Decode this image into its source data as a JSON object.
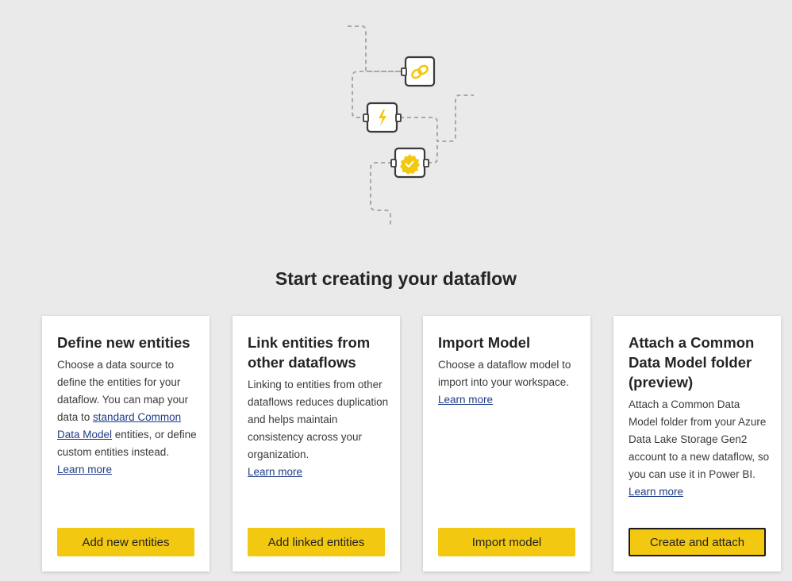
{
  "page": {
    "title": "Start creating your dataflow"
  },
  "illustration": {
    "icons": [
      "link-icon",
      "lightning-icon",
      "verified-badge-icon"
    ],
    "accent": "#f2c811"
  },
  "cards": [
    {
      "title": "Define new entities",
      "desc_before": "Choose a data source to define the entities for your dataflow. You can map your data to ",
      "inline_link": "standard Common Data Model",
      "desc_after": " entities, or define custom entities instead.",
      "learn_more": "Learn more",
      "button": "Add new entities"
    },
    {
      "title": "Link entities from other dataflows",
      "desc": "Linking to entities from other dataflows reduces duplication and helps maintain consistency across your organization.",
      "learn_more": "Learn more",
      "button": "Add linked entities"
    },
    {
      "title": "Import Model",
      "desc": "Choose a dataflow model to import into your workspace.",
      "learn_more": "Learn more",
      "button": "Import model"
    },
    {
      "title": "Attach a Common Data Model folder (preview)",
      "desc": "Attach a Common Data Model folder from your Azure Data Lake Storage Gen2 account to a new dataflow, so you can use it in Power BI.",
      "learn_more": "Learn more",
      "button": "Create and attach"
    }
  ],
  "colors": {
    "background": "#eaeaea",
    "button": "#f2c811",
    "link": "#1f3c88"
  }
}
